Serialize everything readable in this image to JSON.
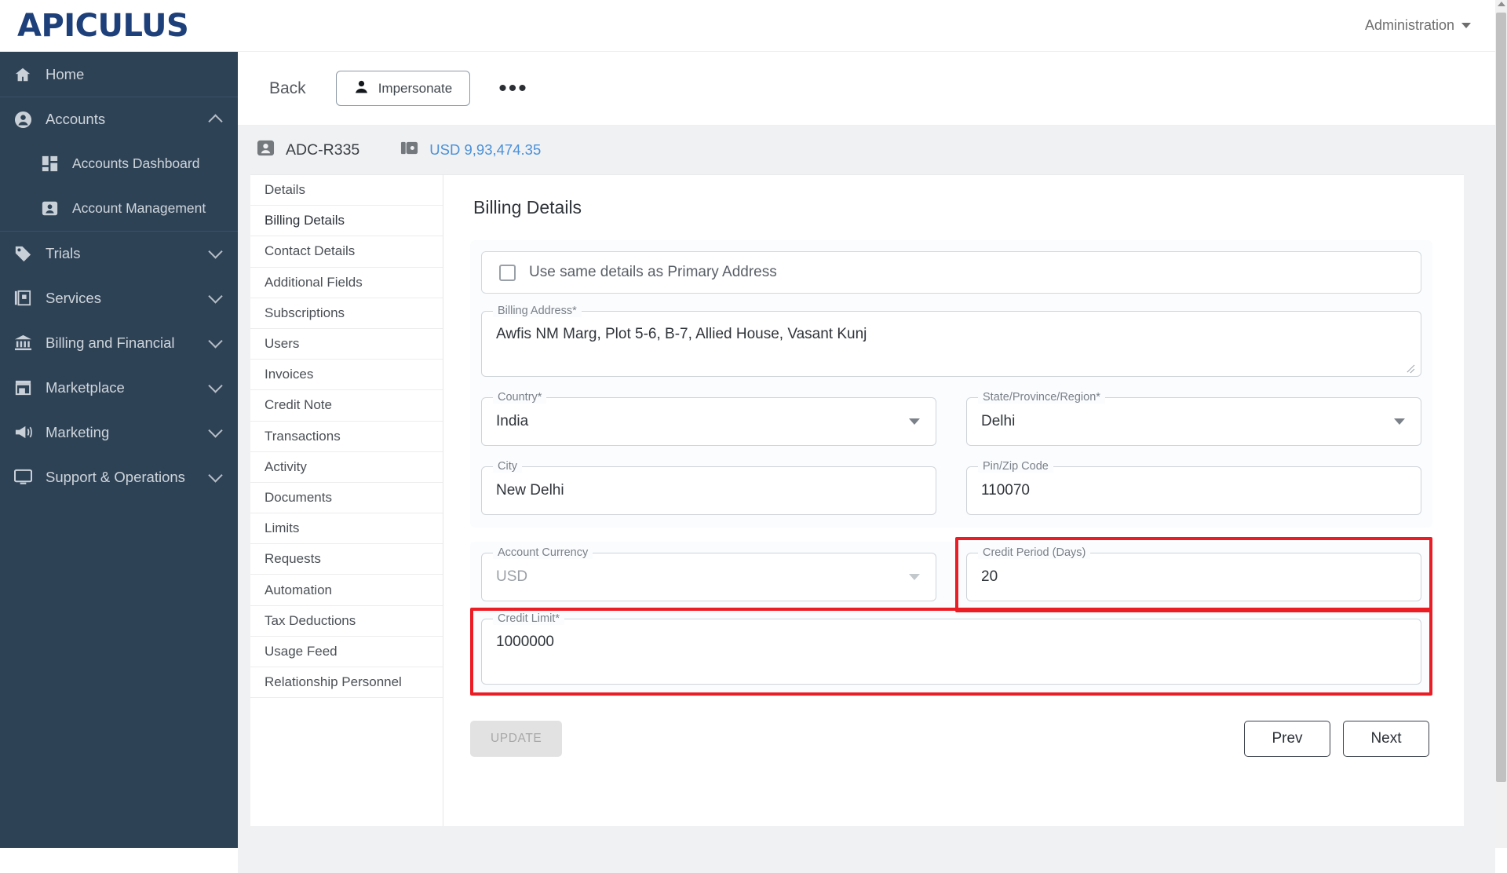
{
  "topbar": {
    "logo": "APICULUS",
    "account_menu": "Administration"
  },
  "sidebar": {
    "items": [
      {
        "label": "Home",
        "icon": "home-icon",
        "expandable": false
      },
      {
        "label": "Accounts",
        "icon": "user-circle-icon",
        "expandable": true,
        "state": "expanded"
      },
      {
        "label": "Accounts Dashboard",
        "icon": "dashboard-grid-icon",
        "sub": true
      },
      {
        "label": "Account Management",
        "icon": "user-card-icon",
        "sub": true
      },
      {
        "label": "Trials",
        "icon": "tag-icon",
        "expandable": true,
        "state": "collapsed"
      },
      {
        "label": "Services",
        "icon": "layers-icon",
        "expandable": true,
        "state": "collapsed"
      },
      {
        "label": "Billing and Financial",
        "icon": "bank-icon",
        "expandable": true,
        "state": "collapsed"
      },
      {
        "label": "Marketplace",
        "icon": "store-icon",
        "expandable": true,
        "state": "collapsed"
      },
      {
        "label": "Marketing",
        "icon": "megaphone-icon",
        "expandable": true,
        "state": "collapsed"
      },
      {
        "label": "Support & Operations",
        "icon": "monitor-icon",
        "expandable": true,
        "state": "collapsed"
      }
    ]
  },
  "action_bar": {
    "back": "Back",
    "impersonate": "Impersonate",
    "more": "•••"
  },
  "account_strip": {
    "account_id": "ADC-R335",
    "balance": "USD 9,93,474.35"
  },
  "tabs": [
    {
      "label": "Details",
      "active": false
    },
    {
      "label": "Billing Details",
      "active": true
    },
    {
      "label": "Contact Details",
      "active": false
    },
    {
      "label": "Additional Fields",
      "active": false
    },
    {
      "label": "Subscriptions",
      "active": false
    },
    {
      "label": "Users",
      "active": false
    },
    {
      "label": "Invoices",
      "active": false
    },
    {
      "label": "Credit Note",
      "active": false
    },
    {
      "label": "Transactions",
      "active": false
    },
    {
      "label": "Activity",
      "active": false
    },
    {
      "label": "Documents",
      "active": false
    },
    {
      "label": "Limits",
      "active": false
    },
    {
      "label": "Requests",
      "active": false
    },
    {
      "label": "Automation",
      "active": false
    },
    {
      "label": "Tax Deductions",
      "active": false
    },
    {
      "label": "Usage Feed",
      "active": false
    },
    {
      "label": "Relationship Personnel",
      "active": false
    }
  ],
  "panel": {
    "title": "Billing Details",
    "same_as_primary": {
      "label": "Use same details as Primary Address",
      "checked": false
    },
    "fields": {
      "billing_address": {
        "label": "Billing Address*",
        "value": "Awfis NM Marg, Plot 5-6,  B-7, Allied House, Vasant Kunj"
      },
      "country": {
        "label": "Country*",
        "value": "India"
      },
      "state": {
        "label": "State/Province/Region*",
        "value": "Delhi"
      },
      "city": {
        "label": "City",
        "value": "New Delhi"
      },
      "pin": {
        "label": "Pin/Zip Code",
        "value": "110070"
      },
      "account_currency": {
        "label": "Account Currency",
        "value": "USD",
        "disabled": true
      },
      "credit_period": {
        "label": "Credit Period (Days)",
        "value": "20",
        "highlighted": true
      },
      "credit_limit": {
        "label": "Credit Limit*",
        "value": "1000000",
        "highlighted": true
      }
    },
    "buttons": {
      "update": "UPDATE",
      "prev": "Prev",
      "next": "Next"
    }
  },
  "colors": {
    "brand": "#1d3f7a",
    "sidebar": "#2e4256",
    "link": "#4a90d9",
    "highlight": "#ec1c24"
  }
}
